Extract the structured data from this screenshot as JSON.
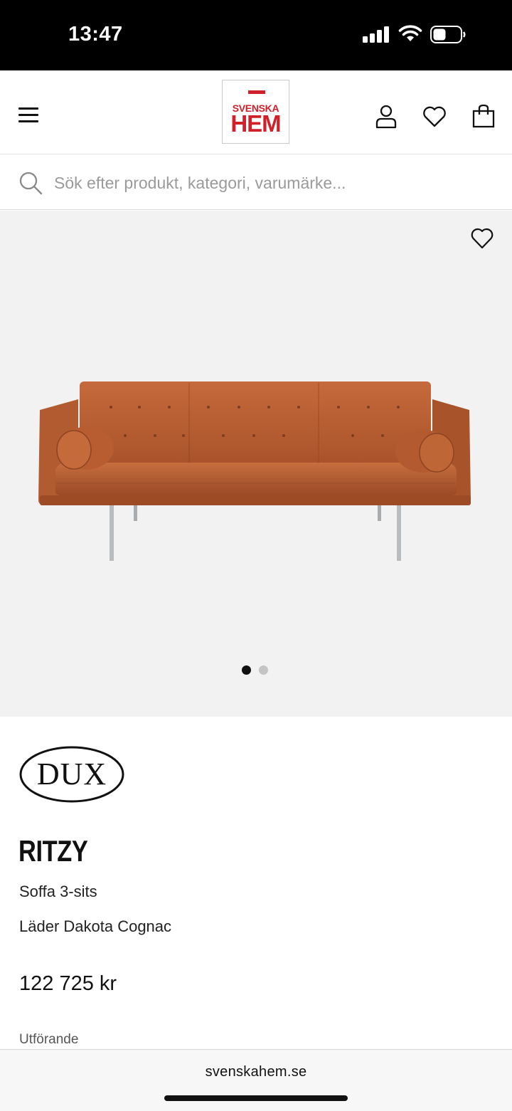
{
  "status_bar": {
    "time": "13:47"
  },
  "header": {
    "logo": {
      "top_text": "SVENSKA",
      "main_text": "HEM",
      "color": "#d0202a"
    },
    "icons": [
      "menu-icon",
      "user-icon",
      "heart-icon",
      "bag-icon"
    ]
  },
  "search": {
    "placeholder": "Sök efter produkt, kategori, varumärke..."
  },
  "gallery": {
    "image_description_icon": "sofa-image",
    "slide_count": 2,
    "active_slide": 1
  },
  "product": {
    "brand": "DUX",
    "name": "RITZY",
    "type": "Soffa 3-sits",
    "material": "Läder Dakota Cognac",
    "price": "122 725 kr",
    "variant_label": "Utförande"
  },
  "browser": {
    "url": "svenskahem.se"
  }
}
